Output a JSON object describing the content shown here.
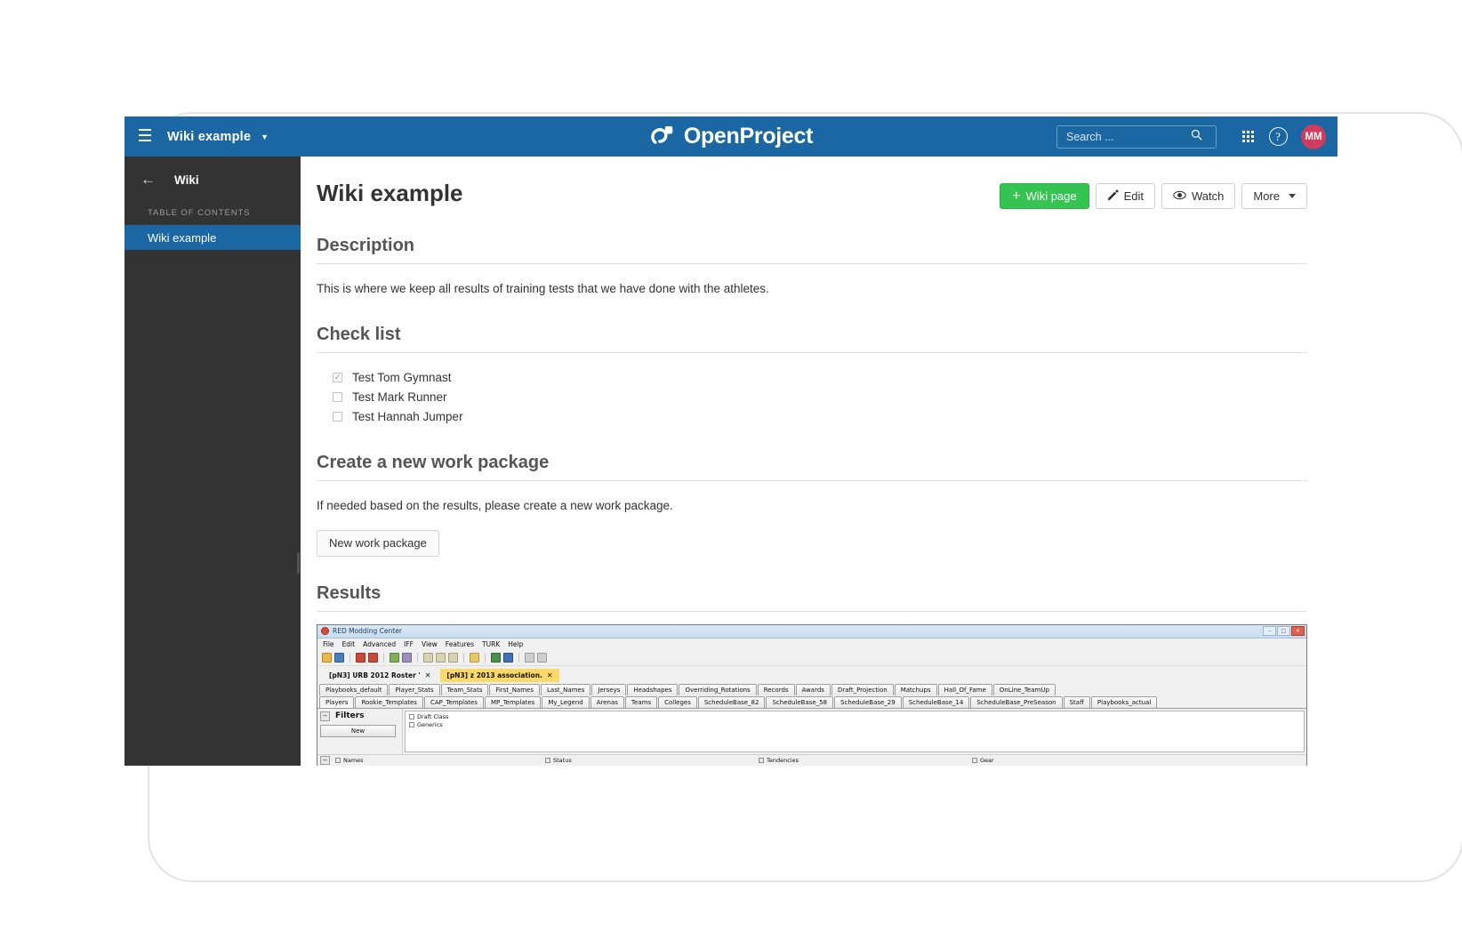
{
  "topbar": {
    "menu_icon": "hamburger-icon",
    "project_name": "Wiki example",
    "brand": "OpenProject",
    "search": {
      "placeholder": "Search ...",
      "value": ""
    },
    "icons": {
      "modules": "grid-icon",
      "help": "?",
      "search": "search-icon"
    },
    "avatar_initials": "MM"
  },
  "sidebar": {
    "back": "←",
    "title": "Wiki",
    "section_label": "TABLE OF CONTENTS",
    "items": [
      {
        "label": "Wiki example",
        "active": true
      }
    ]
  },
  "page": {
    "title": "Wiki example",
    "actions": [
      {
        "label": "Wiki page",
        "icon": "plus-icon",
        "style": "primary"
      },
      {
        "label": "Edit",
        "icon": "pencil-icon",
        "style": "default"
      },
      {
        "label": "Watch",
        "icon": "eye-icon",
        "style": "default"
      },
      {
        "label": "More",
        "icon": "chevron-down-icon",
        "style": "default"
      }
    ]
  },
  "sections": {
    "description": {
      "heading": "Description",
      "body": "This is where we keep all results of training tests that we have done with the athletes."
    },
    "checklist": {
      "heading": "Check list",
      "items": [
        {
          "label": "Test Tom Gymnast",
          "checked": true
        },
        {
          "label": "Test Mark Runner",
          "checked": false
        },
        {
          "label": "Test Hannah Jumper",
          "checked": false
        }
      ]
    },
    "work_package": {
      "heading": "Create a new work package",
      "body": "If needed based on the results, please create a new work package.",
      "button_label": "New work package"
    },
    "results": {
      "heading": "Results"
    }
  },
  "embedded_app": {
    "window_title": "RED Modding Center",
    "window_controls": {
      "minimize": "–",
      "maximize": "□",
      "close": "✕"
    },
    "menu": [
      "File",
      "Edit",
      "Advanced",
      "IFF",
      "View",
      "Features",
      "TURK",
      "Help"
    ],
    "document_tabs": [
      {
        "label": "[pN3] URB 2012 Roster '",
        "close": "✕",
        "active": false
      },
      {
        "label": "[pN3] z 2013 association.",
        "close": "✕",
        "active": true
      }
    ],
    "tab_row_1": [
      "Playbooks_default",
      "Player_Stats",
      "Team_Stats",
      "First_Names",
      "Last_Names",
      "Jerseys",
      "Headshapes",
      "Overriding_Rotations",
      "Records",
      "Awards",
      "Draft_Projection",
      "Matchups",
      "Hall_Of_Fame",
      "OnLine_TeamUp"
    ],
    "tab_row_2": [
      "Players",
      "Rookie_Templates",
      "CAP_Templates",
      "MP_Templates",
      "My_Legend",
      "Arenas",
      "Teams",
      "Colleges",
      "ScheduleBase_82",
      "ScheduleBase_58",
      "ScheduleBase_29",
      "ScheduleBase_14",
      "ScheduleBase_PreSeason",
      "Staff",
      "Playbooks_actual"
    ],
    "tab_row_2_selected": "Players",
    "filters": {
      "title": "Filters",
      "collapse": "−",
      "new_button": "New",
      "checkboxes": [
        {
          "label": "Draft Class",
          "checked": false
        },
        {
          "label": "Generics",
          "checked": false
        }
      ]
    },
    "column_toggles": {
      "collapse": "−",
      "items": [
        {
          "label": "Names",
          "checked": true
        },
        {
          "label": "Status",
          "checked": true
        },
        {
          "label": "Tendencies",
          "checked": true
        },
        {
          "label": "Gear",
          "checked": true
        }
      ]
    }
  },
  "colors": {
    "header_blue": "#1a67a3",
    "sidebar_dark": "#333333",
    "primary_green": "#35c351",
    "avatar_red": "#cf3c5e",
    "highlight_yellow": "#ffd966"
  }
}
